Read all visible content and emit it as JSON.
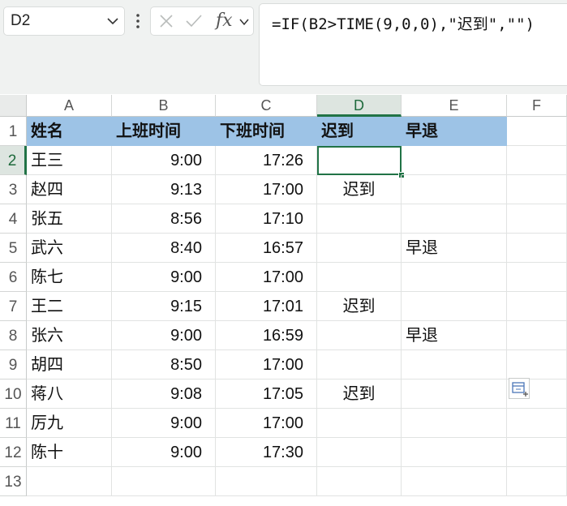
{
  "namebox": {
    "value": "D2"
  },
  "formula_bar": {
    "fx_label": "fx",
    "formula": "=IF(B2>TIME(9,0,0),\"迟到\",\"\")"
  },
  "columns": [
    "A",
    "B",
    "C",
    "D",
    "E",
    "F"
  ],
  "rows": [
    "1",
    "2",
    "3",
    "4",
    "5",
    "6",
    "7",
    "8",
    "9",
    "10",
    "11",
    "12",
    "13"
  ],
  "header": [
    "姓名",
    "上班时间",
    "下班时间",
    "迟到",
    "早退"
  ],
  "data": [
    [
      "王三",
      "9:00",
      "17:26",
      "",
      ""
    ],
    [
      "赵四",
      "9:13",
      "17:00",
      "迟到",
      ""
    ],
    [
      "张五",
      "8:56",
      "17:10",
      "",
      ""
    ],
    [
      "武六",
      "8:40",
      "16:57",
      "",
      "早退"
    ],
    [
      "陈七",
      "9:00",
      "17:00",
      "",
      ""
    ],
    [
      "王二",
      "9:15",
      "17:01",
      "迟到",
      ""
    ],
    [
      "张六",
      "9:00",
      "16:59",
      "",
      "早退"
    ],
    [
      "胡四",
      "8:50",
      "17:00",
      "",
      ""
    ],
    [
      "蒋八",
      "9:08",
      "17:05",
      "迟到",
      ""
    ],
    [
      "厉九",
      "9:00",
      "17:00",
      "",
      ""
    ],
    [
      "陈十",
      "9:00",
      "17:30",
      "",
      ""
    ]
  ],
  "active_cell": "D2",
  "colors": {
    "header_fill": "#9dc3e6",
    "selection": "#217346"
  }
}
